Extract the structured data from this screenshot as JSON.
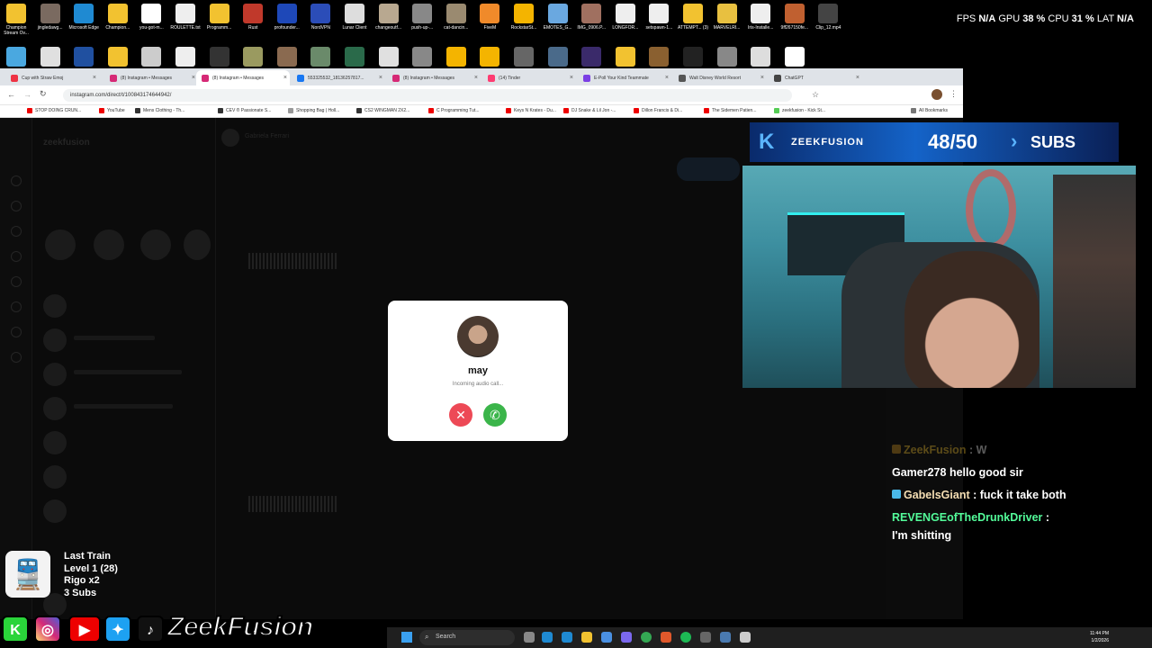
{
  "perf": {
    "fps_label": "FPS",
    "fps_value": "N/A",
    "gpu_label": "GPU",
    "gpu_value": "38 %",
    "cpu_label": "CPU",
    "cpu_value": "31 %",
    "lat_label": "LAT",
    "lat_value": "N/A"
  },
  "desktop_row1": [
    {
      "label": "Champion Stream Ov...",
      "color": "#f2c230"
    },
    {
      "label": "jingledawg...",
      "color": "#7a6a60"
    },
    {
      "label": "Microsoft Edge",
      "color": "#1f8ad2"
    },
    {
      "label": "Champion...",
      "color": "#f2c230"
    },
    {
      "label": "you-got-m...",
      "color": "#ffffff"
    },
    {
      "label": "ROULETTE.txt",
      "color": "#eeeeee"
    },
    {
      "label": "Programm...",
      "color": "#f2c230"
    },
    {
      "label": "Rust",
      "color": "#c0392b"
    },
    {
      "label": "profounder...",
      "color": "#1e48b8"
    },
    {
      "label": "NordVPN",
      "color": "#2b4db8"
    },
    {
      "label": "Lunar Client",
      "color": "#dddddd"
    },
    {
      "label": "changeoutf...",
      "color": "#b8a890"
    },
    {
      "label": "push-up-...",
      "color": "#888888"
    },
    {
      "label": "cat-dancin...",
      "color": "#9a8a70"
    },
    {
      "label": "FiveM",
      "color": "#f08a2a"
    },
    {
      "label": "RockstarSt...",
      "color": "#f4b400"
    },
    {
      "label": "EMOTES_G...",
      "color": "#6aa8e0"
    },
    {
      "label": "IMG_0906.P...",
      "color": "#a07060"
    },
    {
      "label": "LONGFOR...",
      "color": "#eeeeee"
    },
    {
      "label": "setspawn-1...",
      "color": "#eeeeee"
    },
    {
      "label": "ATTEMPT... (3)",
      "color": "#f2c230"
    },
    {
      "label": "MARVELRI...",
      "color": "#e8c040"
    },
    {
      "label": "Iris-Installe...",
      "color": "#eeeeee"
    },
    {
      "label": "9ff267150fe...",
      "color": "#c06030"
    },
    {
      "label": "Clip_12.mp4",
      "color": "#444444"
    }
  ],
  "desktop_row2": [
    {
      "color": "#4aa8e0"
    },
    {
      "color": "#e0e0e0"
    },
    {
      "color": "#2050a0"
    },
    {
      "color": "#f2c230"
    },
    {
      "color": "#cccccc"
    },
    {
      "color": "#eeeeee"
    },
    {
      "color": "#333333"
    },
    {
      "color": "#9a9a60"
    },
    {
      "color": "#8a6a50"
    },
    {
      "color": "#6a8a6a"
    },
    {
      "color": "#2a6a4a"
    },
    {
      "color": "#e0e0e0"
    },
    {
      "color": "#888888"
    },
    {
      "color": "#f4b400"
    },
    {
      "color": "#f4b400"
    },
    {
      "color": "#666666"
    },
    {
      "color": "#4a6a8a"
    },
    {
      "color": "#3a2a6a"
    },
    {
      "color": "#f2c230"
    },
    {
      "color": "#8a6030"
    },
    {
      "color": "#222222"
    },
    {
      "color": "#888888"
    },
    {
      "color": "#dddddd"
    },
    {
      "color": "#ffffff"
    }
  ],
  "browser": {
    "tabs": [
      {
        "label": "Cup with Straw Emoj",
        "fav": "#e34"
      },
      {
        "label": "(8) Instagram • Messages",
        "fav": "#d62976"
      },
      {
        "label": "(8) Instagram • Messages",
        "fav": "#d62976"
      },
      {
        "label": "553325532_18136257817...",
        "fav": "#1877f2"
      },
      {
        "label": "(8) Instagram • Messages",
        "fav": "#d62976"
      },
      {
        "label": "(14) Tinder",
        "fav": "#fe3c72"
      },
      {
        "label": "E-Poll Your Kind Teammate",
        "fav": "#7b3fe4"
      },
      {
        "label": "Walt Disney World Resort",
        "fav": "#555"
      },
      {
        "label": "ChatGPT",
        "fav": "#444"
      }
    ],
    "url": "instagram.com/direct/t/100843174644942/",
    "bookmarks": [
      {
        "label": "STOP DOING CRUN...",
        "color": "#e00"
      },
      {
        "label": "YouTube",
        "color": "#e00"
      },
      {
        "label": "Mens Clothing - Th...",
        "color": "#333"
      },
      {
        "label": "CEV ® Passionate S...",
        "color": "#333"
      },
      {
        "label": "Shopping Bag | Holl...",
        "color": "#999"
      },
      {
        "label": "CS2 WINGMAN 2X2...",
        "color": "#333"
      },
      {
        "label": "C Programming Tut...",
        "color": "#e00"
      },
      {
        "label": "Keys N Krates - Du...",
        "color": "#e00"
      },
      {
        "label": "DJ Snake & Lil Jon -...",
        "color": "#e00"
      },
      {
        "label": "Dillon Francis & Di...",
        "color": "#e00"
      },
      {
        "label": "The Sidemen Patien...",
        "color": "#e00"
      },
      {
        "label": "zeekfusion - Kick St...",
        "color": "#5c5"
      }
    ],
    "all_bookmarks": "All Bookmarks"
  },
  "instagram": {
    "username": "zeekfusion",
    "chat_header": "Gabriela Ferrari"
  },
  "call": {
    "caller_name": "may",
    "status": "Incoming audio call..."
  },
  "subgoal": {
    "channel": "ZEEKFUSION",
    "progress": "48/50",
    "label": "SUBS"
  },
  "chat": [
    {
      "user": "ZeekFusion",
      "text": ": W",
      "user_color": "#f2c230",
      "faded": true,
      "badge": "#c89020"
    },
    {
      "user": "Gamer278",
      "text": "hello good sir",
      "user_color": "#ffffff",
      "faded": false,
      "badge": ""
    },
    {
      "user": "GabelsGiant",
      "text": ": fuck it take both",
      "user_color": "#f5deb3",
      "faded": false,
      "badge": "#4ab8e8"
    },
    {
      "user": "REVENGEofTheDrunkDriver",
      "text": ": I'm shitting",
      "user_color": "#53fc9a",
      "faded": false,
      "badge": ""
    }
  ],
  "train": {
    "title": "Last Train",
    "level": "Level 1  (28)",
    "top": "Rigo x2",
    "subs": "3 Subs"
  },
  "brand": "ZeekFusion",
  "taskbar": {
    "search_placeholder": "Search",
    "time": "11:44 PM",
    "date": "1/2/2026"
  }
}
